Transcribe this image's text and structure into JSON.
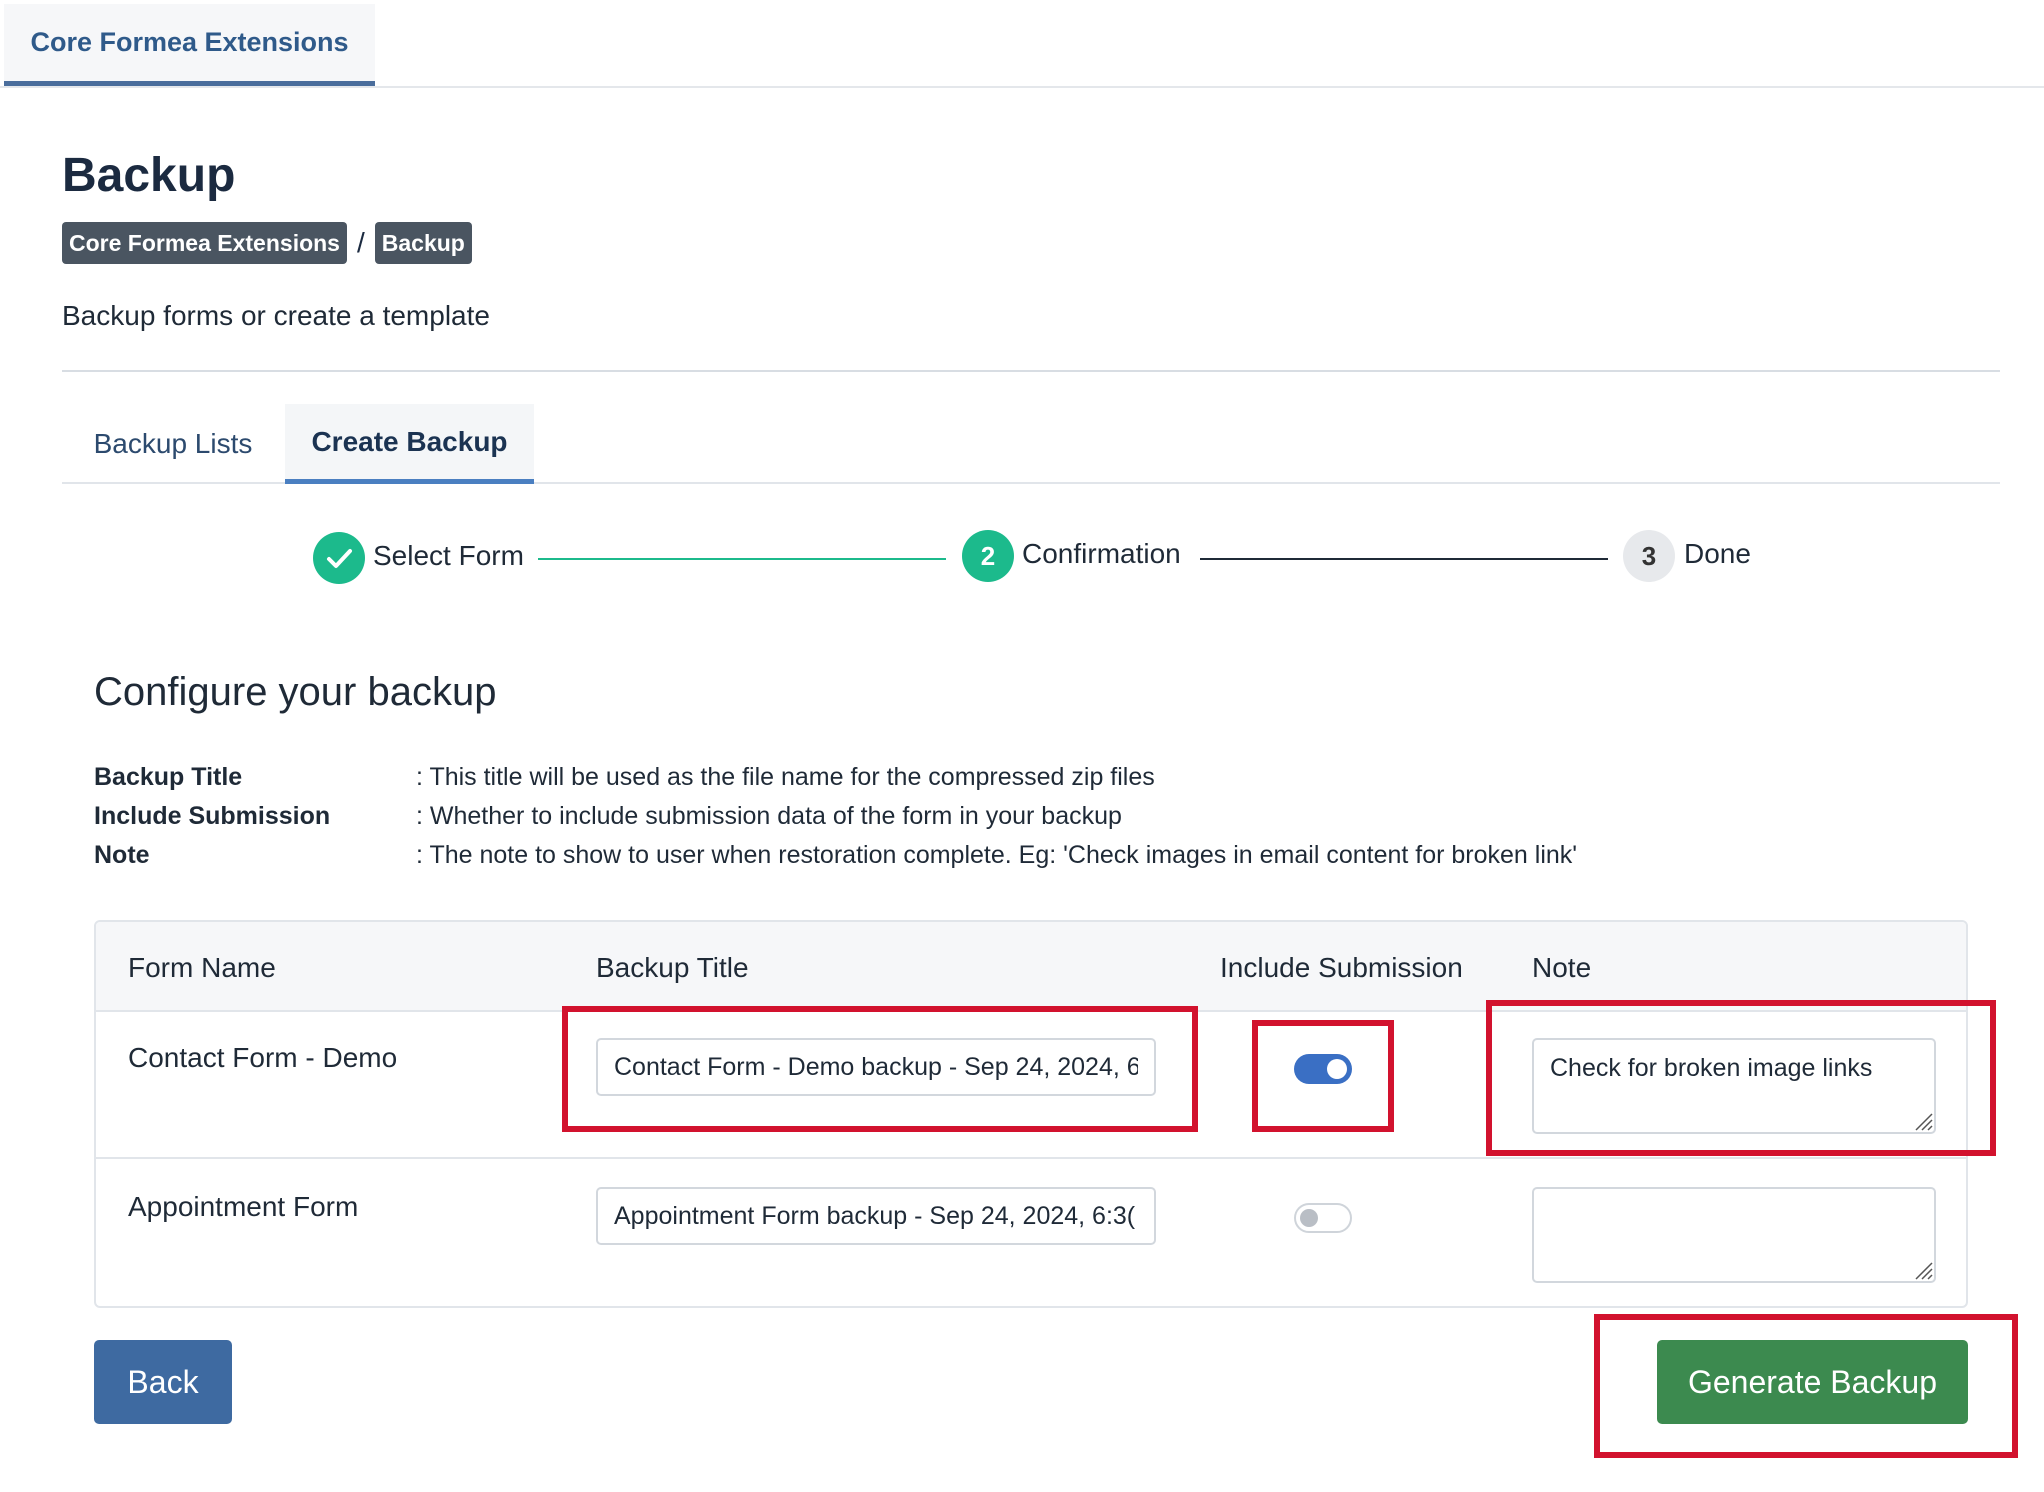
{
  "top_tab": {
    "label": "Core Formea Extensions"
  },
  "page": {
    "title": "Backup",
    "breadcrumb": [
      "Core Formea Extensions",
      "Backup"
    ],
    "breadcrumb_separator": "/",
    "subtitle": "Backup forms or create a template"
  },
  "tabs": [
    {
      "label": "Backup Lists",
      "active": false
    },
    {
      "label": "Create Backup",
      "active": true
    }
  ],
  "stepper": {
    "steps": [
      {
        "number": "1",
        "label": "Select Form",
        "state": "completed"
      },
      {
        "number": "2",
        "label": "Confirmation",
        "state": "active"
      },
      {
        "number": "3",
        "label": "Done",
        "state": "pending"
      }
    ]
  },
  "configure": {
    "title": "Configure your backup",
    "info": [
      {
        "key": "Backup Title",
        "value": ": This title will be used as the file name for the compressed zip files"
      },
      {
        "key": "Include Submission",
        "value": ": Whether to include submission data of the form in your backup"
      },
      {
        "key": "Note",
        "value": ": The note to show to user when restoration complete. Eg: 'Check images in email content for broken link'"
      }
    ]
  },
  "table": {
    "headers": [
      "Form Name",
      "Backup Title",
      "Include Submission",
      "Note"
    ],
    "rows": [
      {
        "form_name": "Contact Form - Demo",
        "backup_title": "Contact Form - Demo backup - Sep 24, 2024, 6",
        "include_submission": true,
        "note": "Check for broken image links"
      },
      {
        "form_name": "Appointment Form",
        "backup_title": "Appointment Form backup - Sep 24, 2024, 6:3(",
        "include_submission": false,
        "note": ""
      }
    ]
  },
  "buttons": {
    "back": "Back",
    "generate": "Generate Backup"
  },
  "colors": {
    "accent": "#1cba8c",
    "primary": "#3e6aa1",
    "success": "#3c8a4f",
    "highlight": "#d2122e",
    "breadcrumb_bg": "#4a5561"
  },
  "icons": {
    "step_completed": "check-icon",
    "textarea_grip": "resize-grip-icon"
  }
}
